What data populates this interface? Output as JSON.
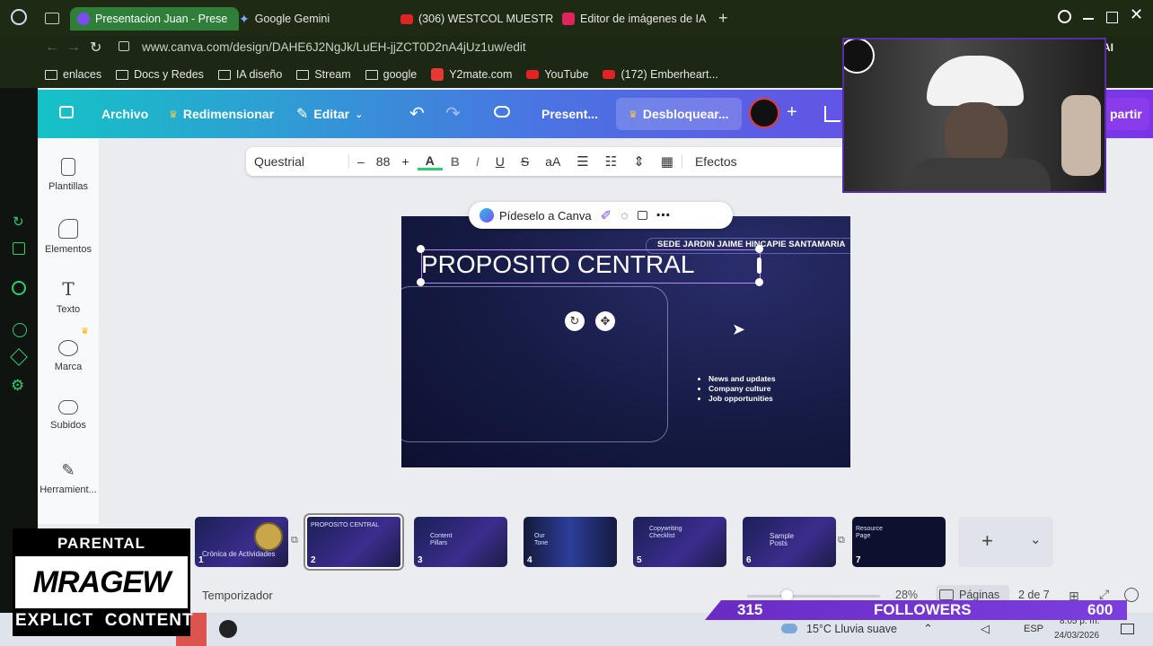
{
  "browser": {
    "tabs": [
      {
        "title": "Presentacion Juan - Prese",
        "active": true,
        "favicon_color": "#7b4df0"
      },
      {
        "title": "Google Gemini",
        "active": false,
        "favicon_color": "#4a8af4"
      },
      {
        "title": "(306) WESTCOL MUESTR",
        "active": false,
        "favicon_color": "#e02424"
      },
      {
        "title": "Editor de imágenes de IA",
        "active": false,
        "favicon_color": "#e0245e"
      }
    ],
    "address": "www.canva.com/design/DAHE6J2NgJk/LuEH-jjZCT0D2nA4jUz1uw/edit",
    "bookmarks": [
      "enlaces",
      "Docs y Redes",
      "IA diseño",
      "Stream",
      "google",
      "Y2mate.com",
      "YouTube",
      "(172) Emberheart..."
    ],
    "ai_label": "AI"
  },
  "canva_header": {
    "archivo": "Archivo",
    "redimensionar": "Redimensionar",
    "editar": "Editar",
    "present": "Present...",
    "desbloquear": "Desbloquear...",
    "compartir": "partir"
  },
  "toolbar": {
    "font": "Questrial",
    "minus": "–",
    "size": "88",
    "plus": "+",
    "text_color": "A",
    "bold": "B",
    "italic": "I",
    "underline": "U",
    "strike": "S",
    "case": "aA",
    "efectos": "Efectos"
  },
  "sidebar": {
    "items": [
      {
        "label": "Plantillas",
        "icon": "templates-icon"
      },
      {
        "label": "Elementos",
        "icon": "elements-icon"
      },
      {
        "label": "Texto",
        "icon": "text-icon"
      },
      {
        "label": "Marca",
        "icon": "brand-icon"
      },
      {
        "label": "Subidos",
        "icon": "upload-icon"
      },
      {
        "label": "Herramient...",
        "icon": "tools-icon"
      }
    ]
  },
  "ask_canva": {
    "label": "Pídeselo a Canva"
  },
  "slide": {
    "tag": "SEDE JARDIN JAIME HINCAPIE SANTAMARIA",
    "title": "PROPOSITO CENTRAL",
    "bullets": [
      "News and updates",
      "Company culture",
      "Job opportunities"
    ]
  },
  "thumbnails": [
    {
      "num": "1",
      "text": "Crónica de Actividades"
    },
    {
      "num": "2",
      "text": "PROPOSITO CENTRAL"
    },
    {
      "num": "3",
      "text": "Content Pillars"
    },
    {
      "num": "4",
      "text": "Our Tone"
    },
    {
      "num": "5",
      "text": "Copywriting Checklist"
    },
    {
      "num": "6",
      "text": "Sample Posts"
    },
    {
      "num": "7",
      "text": "Resource Page"
    }
  ],
  "bottom": {
    "temporizador": "Temporizador",
    "zoom": "28%",
    "paginas": "Páginas",
    "pages": "2 de 7"
  },
  "taskbar": {
    "weather": "15°C  Lluvia suave",
    "lang": "ESP",
    "time": "8:05 p. m.",
    "date": "24/03/2026"
  },
  "overlay": {
    "followers_count": "315",
    "followers_label": "FOLLOWERS",
    "followers_goal": "600",
    "advisory_top": "PARENTAL ADVISORY",
    "advisory_logo": "MRAGEW",
    "advisory_bottom": "EXPLICT  CONTENT"
  },
  "colors": {
    "canva_gradient_start": "#15c3c6",
    "canva_gradient_end": "#7b34e8",
    "slide_bg": "#161b44",
    "followers_bar": "#7b3fe0"
  }
}
